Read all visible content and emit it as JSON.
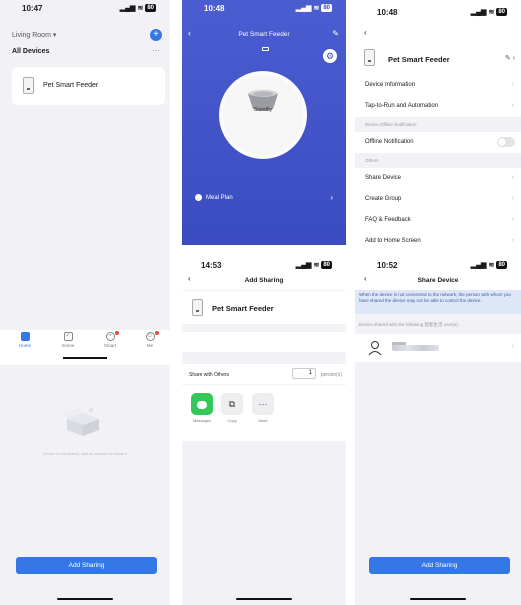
{
  "panel1": {
    "time": "10:47",
    "location": "Living Room ▾",
    "section_title": "All Devices",
    "more": "···",
    "device_name": "Pet Smart Feeder",
    "tabs": [
      {
        "label": "Home",
        "icon": "home-icon"
      },
      {
        "label": "Scene",
        "icon": "scene-icon"
      },
      {
        "label": "Smart",
        "icon": "smart-icon"
      },
      {
        "label": "Me",
        "icon": "me-icon"
      }
    ],
    "empty_text": "Device is not shared, add an account to share it",
    "add_sharing": "Add Sharing"
  },
  "panel2": {
    "time": "10:48",
    "title": "Pet Smart Feeder",
    "status": "Standby",
    "meal_plan": "Meal Plan",
    "bottom": {
      "time": "14:53",
      "title": "Add Sharing",
      "device_name": "Pet Smart Feeder",
      "share_label": "Share with Others",
      "person_count": "1",
      "person_unit": "person(s)",
      "options": [
        {
          "label": "Messages",
          "icon": "messages-icon"
        },
        {
          "label": "Copy",
          "icon": "copy-icon"
        },
        {
          "label": "More",
          "icon": "more-icon"
        }
      ]
    }
  },
  "panel3": {
    "time": "10:48",
    "device_name": "Pet Smart Feeder",
    "menu": [
      "Device Information",
      "Tap-to-Run and Automation"
    ],
    "offline_section": "Device Offline Notification",
    "offline_label": "Offline Notification",
    "others_section": "Others",
    "others": [
      "Share Device",
      "Create Group",
      "FAQ & Feedback",
      "Add to Home Screen"
    ],
    "bottom": {
      "time": "10:52",
      "title": "Share Device",
      "info": "When the device is not connected to the network, the person with whom you have shared the device may not be able to control the device.",
      "shared_with": "Device shared with the following 智能生活 user(s):",
      "add_sharing": "Add Sharing"
    }
  },
  "colors": {
    "accent": "#3578e5",
    "feeder_bg": "#3b4cc0",
    "info_bg": "#dde7f8"
  }
}
